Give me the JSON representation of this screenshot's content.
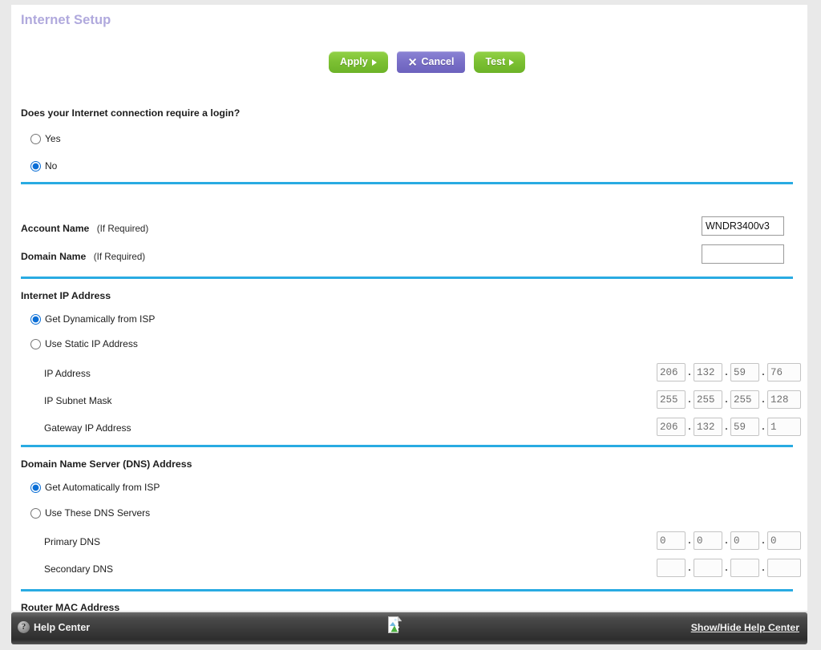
{
  "page": {
    "title": "Internet Setup"
  },
  "toolbar": {
    "apply_label": "Apply",
    "cancel_label": "Cancel",
    "test_label": "Test",
    "apply_icon": "triangle-right-icon",
    "cancel_icon": "x-icon",
    "test_icon": "triangle-right-icon"
  },
  "login_section": {
    "question": "Does your Internet connection require a login?",
    "options": [
      {
        "label": "Yes",
        "checked": false
      },
      {
        "label": "No",
        "checked": true
      }
    ]
  },
  "account_section": {
    "account_name_label": "Account Name",
    "account_name_hint": "(If Required)",
    "account_name_value": "WNDR3400v3",
    "domain_name_label": "Domain Name",
    "domain_name_hint": "(If Required)",
    "domain_name_value": ""
  },
  "internet_ip": {
    "heading": "Internet IP Address",
    "options": [
      {
        "label": "Get Dynamically from ISP",
        "checked": true
      },
      {
        "label": "Use Static IP Address",
        "checked": false
      }
    ],
    "fields": [
      {
        "label": "IP Address",
        "octets": [
          "206",
          "132",
          "59",
          "76"
        ]
      },
      {
        "label": "IP Subnet Mask",
        "octets": [
          "255",
          "255",
          "255",
          "128"
        ]
      },
      {
        "label": "Gateway IP Address",
        "octets": [
          "206",
          "132",
          "59",
          "1"
        ]
      }
    ]
  },
  "dns": {
    "heading": "Domain Name Server (DNS) Address",
    "options": [
      {
        "label": "Get Automatically from ISP",
        "checked": true
      },
      {
        "label": "Use These DNS Servers",
        "checked": false
      }
    ],
    "fields": [
      {
        "label": "Primary DNS",
        "octets": [
          "0",
          "0",
          "0",
          "0"
        ]
      },
      {
        "label": "Secondary DNS",
        "octets": [
          "",
          "",
          "",
          ""
        ]
      }
    ]
  },
  "mac_section": {
    "heading": "Router MAC Address"
  },
  "footer": {
    "help_center_label": "Help Center",
    "help_center_icon": "question-mark-icon",
    "center_icon": "broken-image-icon",
    "show_hide_label": "Show/Hide Help Center"
  },
  "colors": {
    "title": "#b0a9dd",
    "divider": "#29abe2",
    "apply_green": "#7cc032",
    "cancel_purple": "#7a70c8",
    "radio_blue": "#0a6ed6",
    "footer_dark": "#3a3a3a"
  }
}
